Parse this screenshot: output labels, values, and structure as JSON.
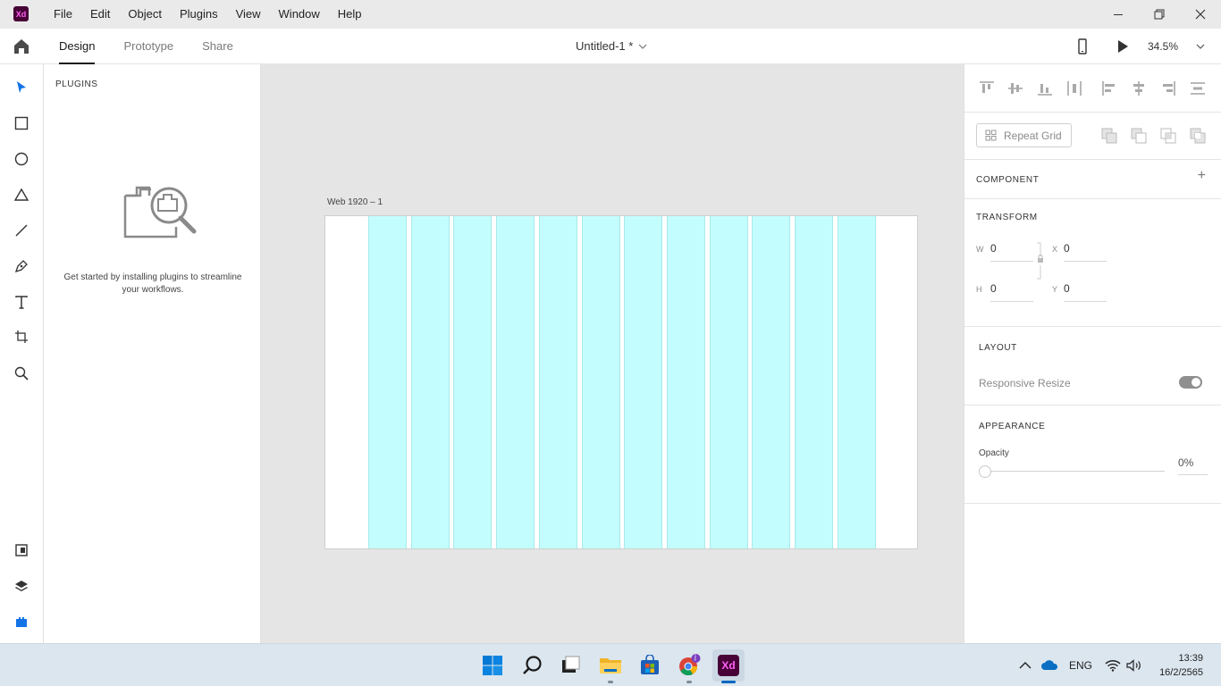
{
  "app": {
    "logo_text": "Xd"
  },
  "menu": [
    "File",
    "Edit",
    "Object",
    "Plugins",
    "View",
    "Window",
    "Help"
  ],
  "modebar": {
    "tabs": [
      {
        "label": "Design",
        "active": true
      },
      {
        "label": "Prototype",
        "active": false
      },
      {
        "label": "Share",
        "active": false
      }
    ],
    "doc_title": "Untitled-1 *",
    "zoom": "34.5%"
  },
  "tools": [
    "select-tool-icon",
    "rectangle-tool-icon",
    "ellipse-tool-icon",
    "polygon-tool-icon",
    "line-tool-icon",
    "pen-tool-icon",
    "text-tool-icon",
    "artboard-tool-icon",
    "zoom-tool-icon",
    "assets-icon",
    "layers-icon",
    "plugins-icon"
  ],
  "plugins_panel": {
    "heading": "PLUGINS",
    "message": "Get started by installing plugins to streamline your workflows."
  },
  "canvas": {
    "artboard_label": "Web 1920 – 1",
    "grid_color": "#c3fdfd",
    "column_count": 12
  },
  "inspector": {
    "repeat_grid_label": "Repeat Grid",
    "component_title": "COMPONENT",
    "transform_title": "TRANSFORM",
    "w_label": "W",
    "w_value": "0",
    "x_label": "X",
    "x_value": "0",
    "h_label": "H",
    "h_value": "0",
    "y_label": "Y",
    "y_value": "0",
    "layout_title": "LAYOUT",
    "responsive_label": "Responsive Resize",
    "appearance_title": "APPEARANCE",
    "opacity_label": "Opacity",
    "opacity_value": "0%"
  },
  "taskbar": {
    "language": "ENG",
    "time": "13:39",
    "date": "16/2/2565",
    "chrome_badge": "j"
  },
  "colors": {
    "xd_brand": "#470137",
    "xd_pink": "#ff61f6",
    "tool_active": "#1473e6",
    "windows_blue": "#0067c0"
  }
}
